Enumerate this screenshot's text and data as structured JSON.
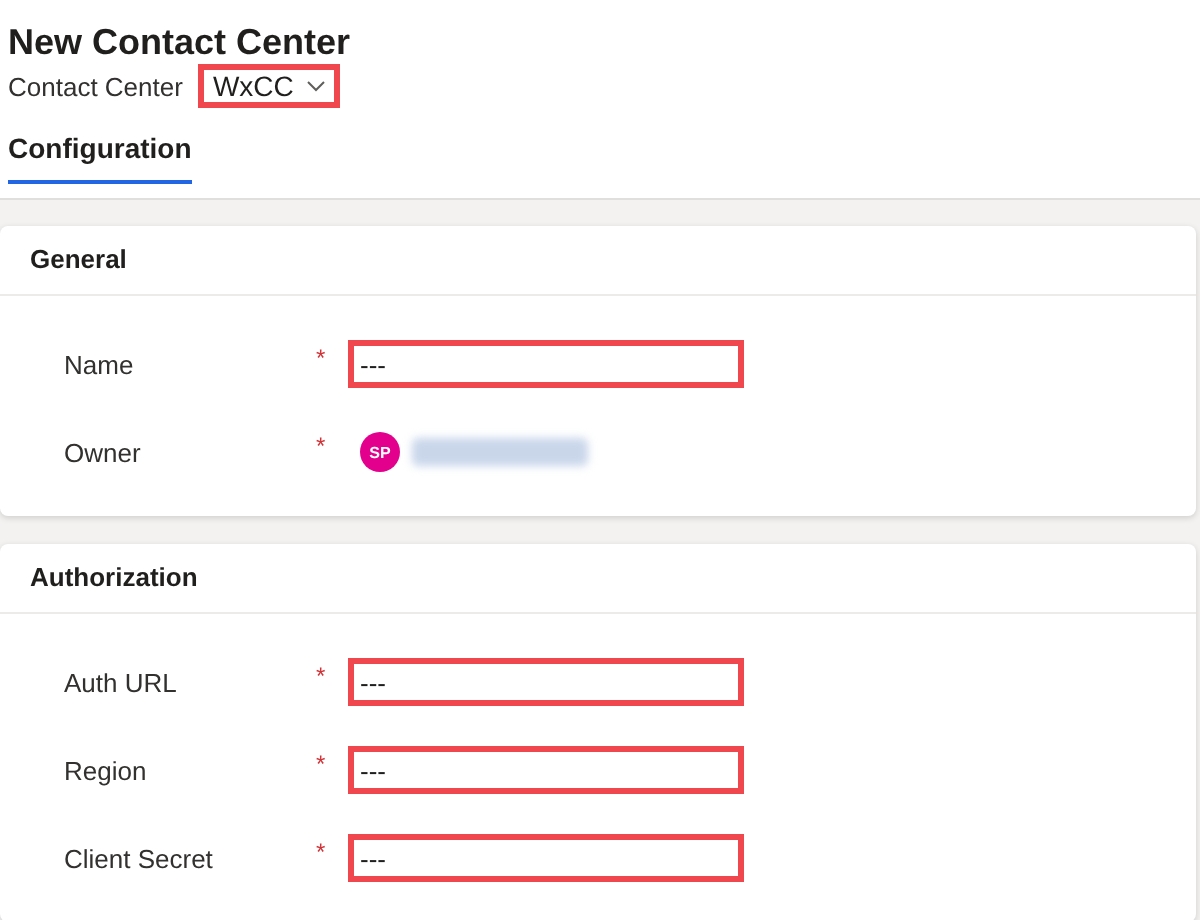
{
  "header": {
    "title": "New Contact Center",
    "entity_label": "Contact Center",
    "form_selector": {
      "value": "WxCC",
      "highlighted": true
    }
  },
  "tabs": [
    {
      "label": "Configuration",
      "selected": true
    }
  ],
  "sections": [
    {
      "title": "General",
      "fields": [
        {
          "kind": "text",
          "label": "Name",
          "required_mark": "*",
          "value": "---",
          "highlighted": true
        },
        {
          "kind": "lookup",
          "label": "Owner",
          "required_mark": "*",
          "avatar": "SP",
          "highlighted": false
        }
      ]
    },
    {
      "title": "Authorization",
      "fields": [
        {
          "kind": "text",
          "label": "Auth URL",
          "required_mark": "*",
          "value": "---",
          "highlighted": true
        },
        {
          "kind": "text",
          "label": "Region",
          "required_mark": "*",
          "value": "---",
          "highlighted": true
        },
        {
          "kind": "text",
          "label": "Client Secret",
          "required_mark": "*",
          "value": "---",
          "highlighted": true
        }
      ]
    }
  ]
}
